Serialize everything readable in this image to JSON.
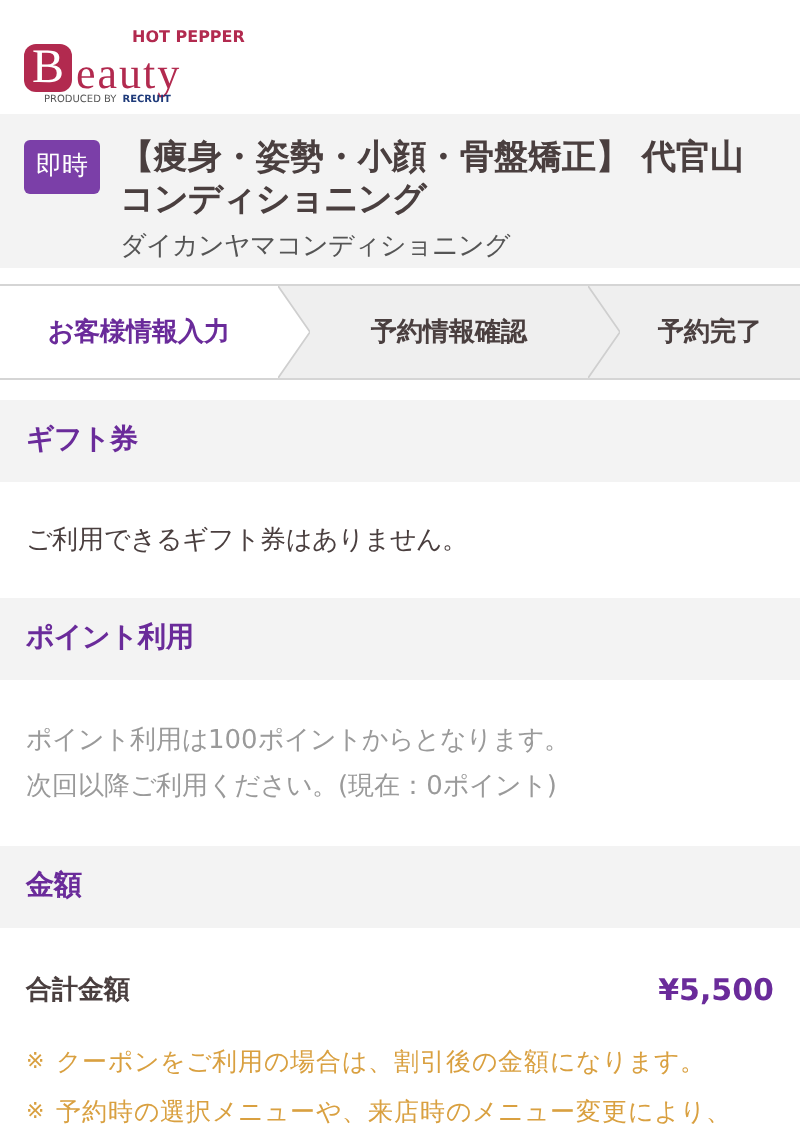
{
  "logo": {
    "top": "HOT PEPPER",
    "initial": "B",
    "word": "eauty",
    "produced_by": "PRODUCED BY",
    "company": "RECRUIT"
  },
  "salon": {
    "badge": "即時",
    "name": "【痩身・姿勢・小顔・骨盤矯正】 代官山コンディショニング",
    "kana": "ダイカンヤマコンディショニング"
  },
  "steps": [
    {
      "label": "お客様情報入力",
      "selected": true
    },
    {
      "label": "予約情報確認",
      "selected": false
    },
    {
      "label": "予約完了",
      "selected": false
    }
  ],
  "sections": [
    {
      "title": "ギフト券",
      "kind": "text",
      "lines": [
        "ご利用できるギフト券はありません。"
      ]
    },
    {
      "title": "ポイント利用",
      "kind": "muted",
      "lines": [
        "ポイント利用は100ポイントからとなります。",
        "次回以降ご利用ください。(現在：0ポイント)"
      ]
    },
    {
      "title": "金額",
      "kind": "total",
      "total_label": "合計金額",
      "total_value": "¥5,500",
      "notes": [
        {
          "mark": "※",
          "text": "クーポンをご利用の場合は、割引後の金額になります。"
        },
        {
          "mark": "※",
          "text": "予約時の選択メニューや、来店時のメニュー変更により、"
        }
      ]
    }
  ]
}
